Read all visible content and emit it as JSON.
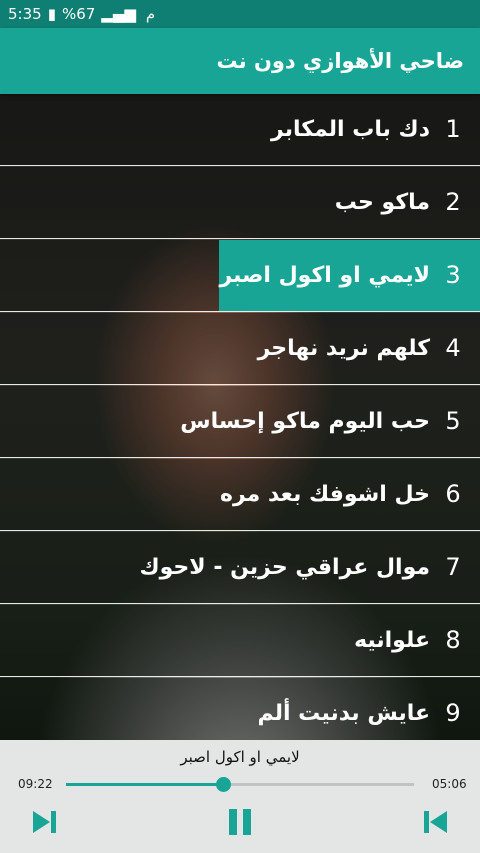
{
  "status_bar": {
    "carrier_icon": "signal-icon",
    "battery_text": "%67",
    "time": "5:35",
    "am_pm": "م"
  },
  "app_bar": {
    "title": "ضاحي الأهوازي دون نت"
  },
  "tracks": [
    {
      "number": "1",
      "title": "دك باب المكابر"
    },
    {
      "number": "2",
      "title": "ماكو حب"
    },
    {
      "number": "3",
      "title": "لايمي او اكول اصبر"
    },
    {
      "number": "4",
      "title": "كلهم نريد نهاجر"
    },
    {
      "number": "5",
      "title": "حب اليوم ماكو إحساس"
    },
    {
      "number": "6",
      "title": "خل اشوفك بعد مره"
    },
    {
      "number": "7",
      "title": "موال عراقي حزين - لاحوك"
    },
    {
      "number": "8",
      "title": "علوانيه"
    },
    {
      "number": "9",
      "title": "عايش بدنيت ألم"
    }
  ],
  "active_track_index": 2,
  "player": {
    "now_playing": "لايمي او اكول اصبر",
    "elapsed": "09:22",
    "duration": "05:06",
    "progress_fraction": 0.45,
    "buttons": [
      "next-icon",
      "pause-icon",
      "previous-icon"
    ]
  },
  "colors": {
    "accent": "#18a596",
    "status_bar": "#0e7f72",
    "player_bg": "#e3e6e5"
  }
}
